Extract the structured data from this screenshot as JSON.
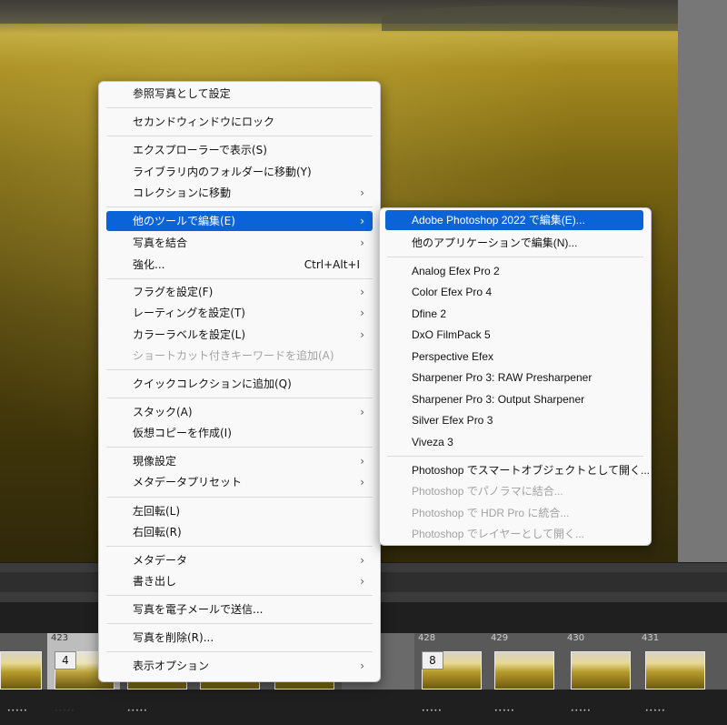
{
  "main_menu": {
    "items": [
      {
        "label": "参照写真として設定"
      },
      {
        "label": "セカンドウィンドウにロック"
      },
      {
        "label": "エクスプローラーで表示(S)"
      },
      {
        "label": "ライブラリ内のフォルダーに移動(Y)"
      },
      {
        "label": "コレクションに移動",
        "submenu": true
      },
      {
        "label": "他のツールで編集(E)",
        "submenu": true,
        "highlighted": true
      },
      {
        "label": "写真を結合",
        "submenu": true
      },
      {
        "label": "強化...",
        "shortcut": "Ctrl+Alt+I"
      },
      {
        "label": "フラグを設定(F)",
        "submenu": true
      },
      {
        "label": "レーティングを設定(T)",
        "submenu": true
      },
      {
        "label": "カラーラベルを設定(L)",
        "submenu": true
      },
      {
        "label": "ショートカット付きキーワードを追加(A)",
        "disabled": true
      },
      {
        "label": "クイックコレクションに追加(Q)"
      },
      {
        "label": "スタック(A)",
        "submenu": true
      },
      {
        "label": "仮想コピーを作成(I)"
      },
      {
        "label": "現像設定",
        "submenu": true
      },
      {
        "label": "メタデータプリセット",
        "submenu": true
      },
      {
        "label": "左回転(L)"
      },
      {
        "label": "右回転(R)"
      },
      {
        "label": "メタデータ",
        "submenu": true
      },
      {
        "label": "書き出し",
        "submenu": true
      },
      {
        "label": "写真を電子メールで送信..."
      },
      {
        "label": "写真を削除(R)..."
      },
      {
        "label": "表示オプション",
        "submenu": true
      }
    ],
    "chevron": "›"
  },
  "sub_menu": {
    "items": [
      {
        "label": "Adobe Photoshop 2022 で編集(E)...",
        "highlighted": true
      },
      {
        "label": "他のアプリケーションで編集(N)..."
      },
      {
        "label": "Analog Efex Pro 2"
      },
      {
        "label": "Color Efex Pro 4"
      },
      {
        "label": "Dfine 2"
      },
      {
        "label": "DxO FilmPack 5"
      },
      {
        "label": "Perspective Efex"
      },
      {
        "label": "Sharpener Pro 3: RAW Presharpener"
      },
      {
        "label": "Sharpener Pro 3: Output Sharpener"
      },
      {
        "label": "Silver Efex Pro 3"
      },
      {
        "label": "Viveza 3"
      },
      {
        "label": "Photoshop でスマートオブジェクトとして開く..."
      },
      {
        "label": "Photoshop でパノラマに結合...",
        "disabled": true
      },
      {
        "label": "Photoshop で HDR Pro に統合...",
        "disabled": true
      },
      {
        "label": "Photoshop でレイヤーとして開く...",
        "disabled": true
      }
    ]
  },
  "filmstrip": {
    "cells": [
      {
        "num": ""
      },
      {
        "num": "423",
        "badge": "4",
        "selected": true
      },
      {
        "num": ""
      },
      {
        "num": ""
      },
      {
        "num": ""
      },
      {
        "num": ""
      },
      {
        "num": "428",
        "badge": "8"
      },
      {
        "num": "429"
      },
      {
        "num": "430"
      },
      {
        "num": "431"
      },
      {
        "num": ""
      }
    ],
    "stars": "•••••"
  },
  "colors": {
    "highlight": "#0a64d8",
    "menu_bg": "#f9f9f9"
  }
}
